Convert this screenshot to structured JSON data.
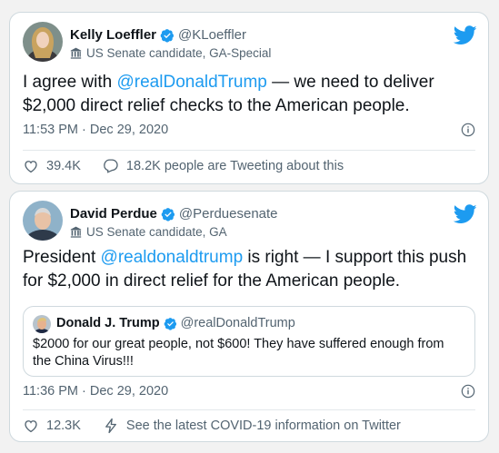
{
  "colors": {
    "accent": "#1d9bf0",
    "text": "#0f1419",
    "secondary": "#536471",
    "border": "#cfd9de",
    "background": "#f2f2f2"
  },
  "tweets": [
    {
      "author_name": "Kelly Loeffler",
      "handle": "@KLoeffler",
      "label": "US Senate candidate, GA-Special",
      "text_before": "I agree with ",
      "mention": "@realDonaldTrump",
      "text_after": " — we need to deliver $2,000 direct relief checks to the American people.",
      "timestamp": "11:53 PM · Dec 29, 2020",
      "likes": "39.4K",
      "secondary_action": "18.2K people are Tweeting about this",
      "icons": [
        "verified-icon",
        "government-label-icon",
        "twitter-bird-icon",
        "info-icon",
        "heart-icon",
        "reply-icon"
      ]
    },
    {
      "author_name": "David Perdue",
      "handle": "@Perduesenate",
      "label": "US Senate candidate, GA",
      "text_before": "President ",
      "mention": "@realdonaldtrump",
      "text_after": " is right — I support this push for $2,000 in direct relief for the American people.",
      "timestamp": "11:36 PM · Dec 29, 2020",
      "likes": "12.3K",
      "secondary_action": "See the latest COVID-19 information on Twitter",
      "quoted": {
        "author_name": "Donald J. Trump",
        "handle": "@realDonaldTrump",
        "text": "$2000 for our great people, not $600! They have suffered enough from the China Virus!!!"
      },
      "icons": [
        "verified-icon",
        "government-label-icon",
        "twitter-bird-icon",
        "info-icon",
        "heart-icon",
        "lightning-icon"
      ]
    }
  ]
}
